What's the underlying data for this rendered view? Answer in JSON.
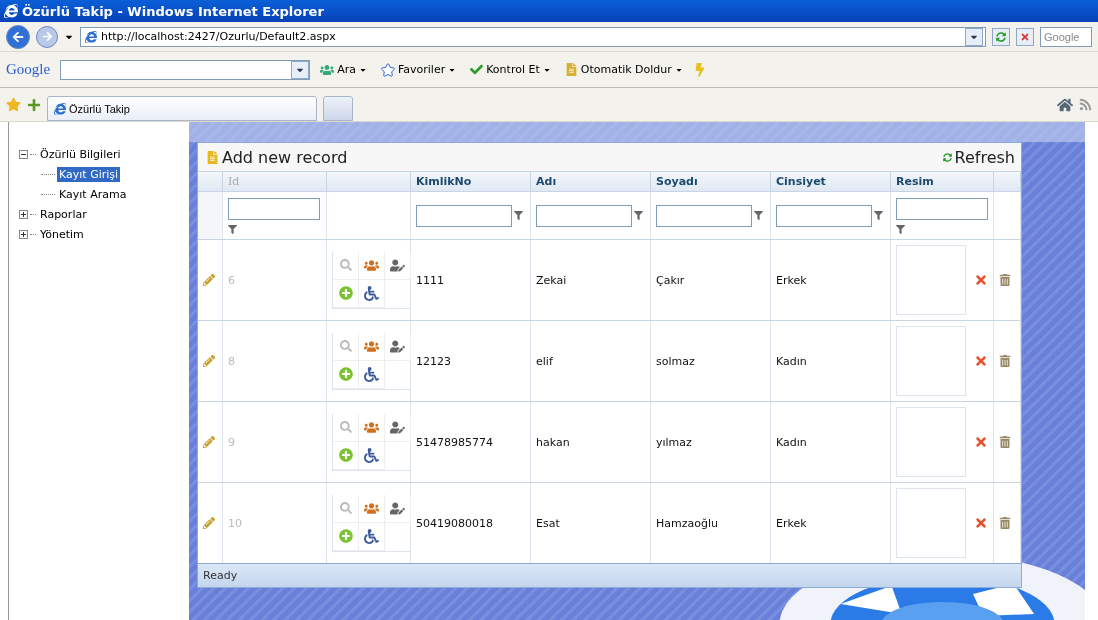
{
  "window": {
    "title": "Özürlü Takip - Windows Internet Explorer"
  },
  "address_bar": {
    "url": "http://localhost:2427/Ozurlu/Default2.aspx"
  },
  "search_box": {
    "placeholder": "Google"
  },
  "google_toolbar": {
    "logo": "Google",
    "buttons": [
      {
        "label": "Ara",
        "kind": "search"
      },
      {
        "label": "Favoriler",
        "kind": "star"
      },
      {
        "label": "Kontrol Et",
        "kind": "spell"
      },
      {
        "label": "Otomatik Doldur",
        "kind": "fill"
      }
    ]
  },
  "tabs": [
    {
      "label": "Özürlü Takip",
      "selected": true
    }
  ],
  "tree": [
    {
      "label": "Özürlü Bilgileri",
      "expanded": true,
      "selected": false,
      "children": [
        {
          "label": "Kayıt Girişi",
          "selected": true
        },
        {
          "label": "Kayıt Arama",
          "selected": false
        }
      ]
    },
    {
      "label": "Raporlar",
      "expanded": false,
      "selected": false
    },
    {
      "label": "Yönetim",
      "expanded": false,
      "selected": false
    }
  ],
  "grid": {
    "add_label": "Add new record",
    "refresh_label": "Refresh",
    "columns": [
      {
        "label": "Id",
        "readonly": true,
        "filter": true
      },
      {
        "label": "KimlikNo",
        "readonly": false,
        "filter": true
      },
      {
        "label": "Adı",
        "readonly": false,
        "filter": true
      },
      {
        "label": "Soyadı",
        "readonly": false,
        "filter": true
      },
      {
        "label": "Cinsiyet",
        "readonly": false,
        "filter": true
      },
      {
        "label": "Resim",
        "readonly": false,
        "filter": true
      }
    ],
    "rows": [
      {
        "id": "6",
        "kimlik_no": "1111",
        "adi": "Zekai",
        "soyadi": "Çakır",
        "cinsiyet": "Erkek"
      },
      {
        "id": "8",
        "kimlik_no": "12123",
        "adi": "elif",
        "soyadi": "solmaz",
        "cinsiyet": "Kadın"
      },
      {
        "id": "9",
        "kimlik_no": "51478985774",
        "adi": "hakan",
        "soyadi": "yılmaz",
        "cinsiyet": "Kadın"
      },
      {
        "id": "10",
        "kimlik_no": "50419080018",
        "adi": "Esat",
        "soyadi": "Hamzaoğlu",
        "cinsiyet": "Erkek"
      }
    ],
    "status": "Ready"
  }
}
